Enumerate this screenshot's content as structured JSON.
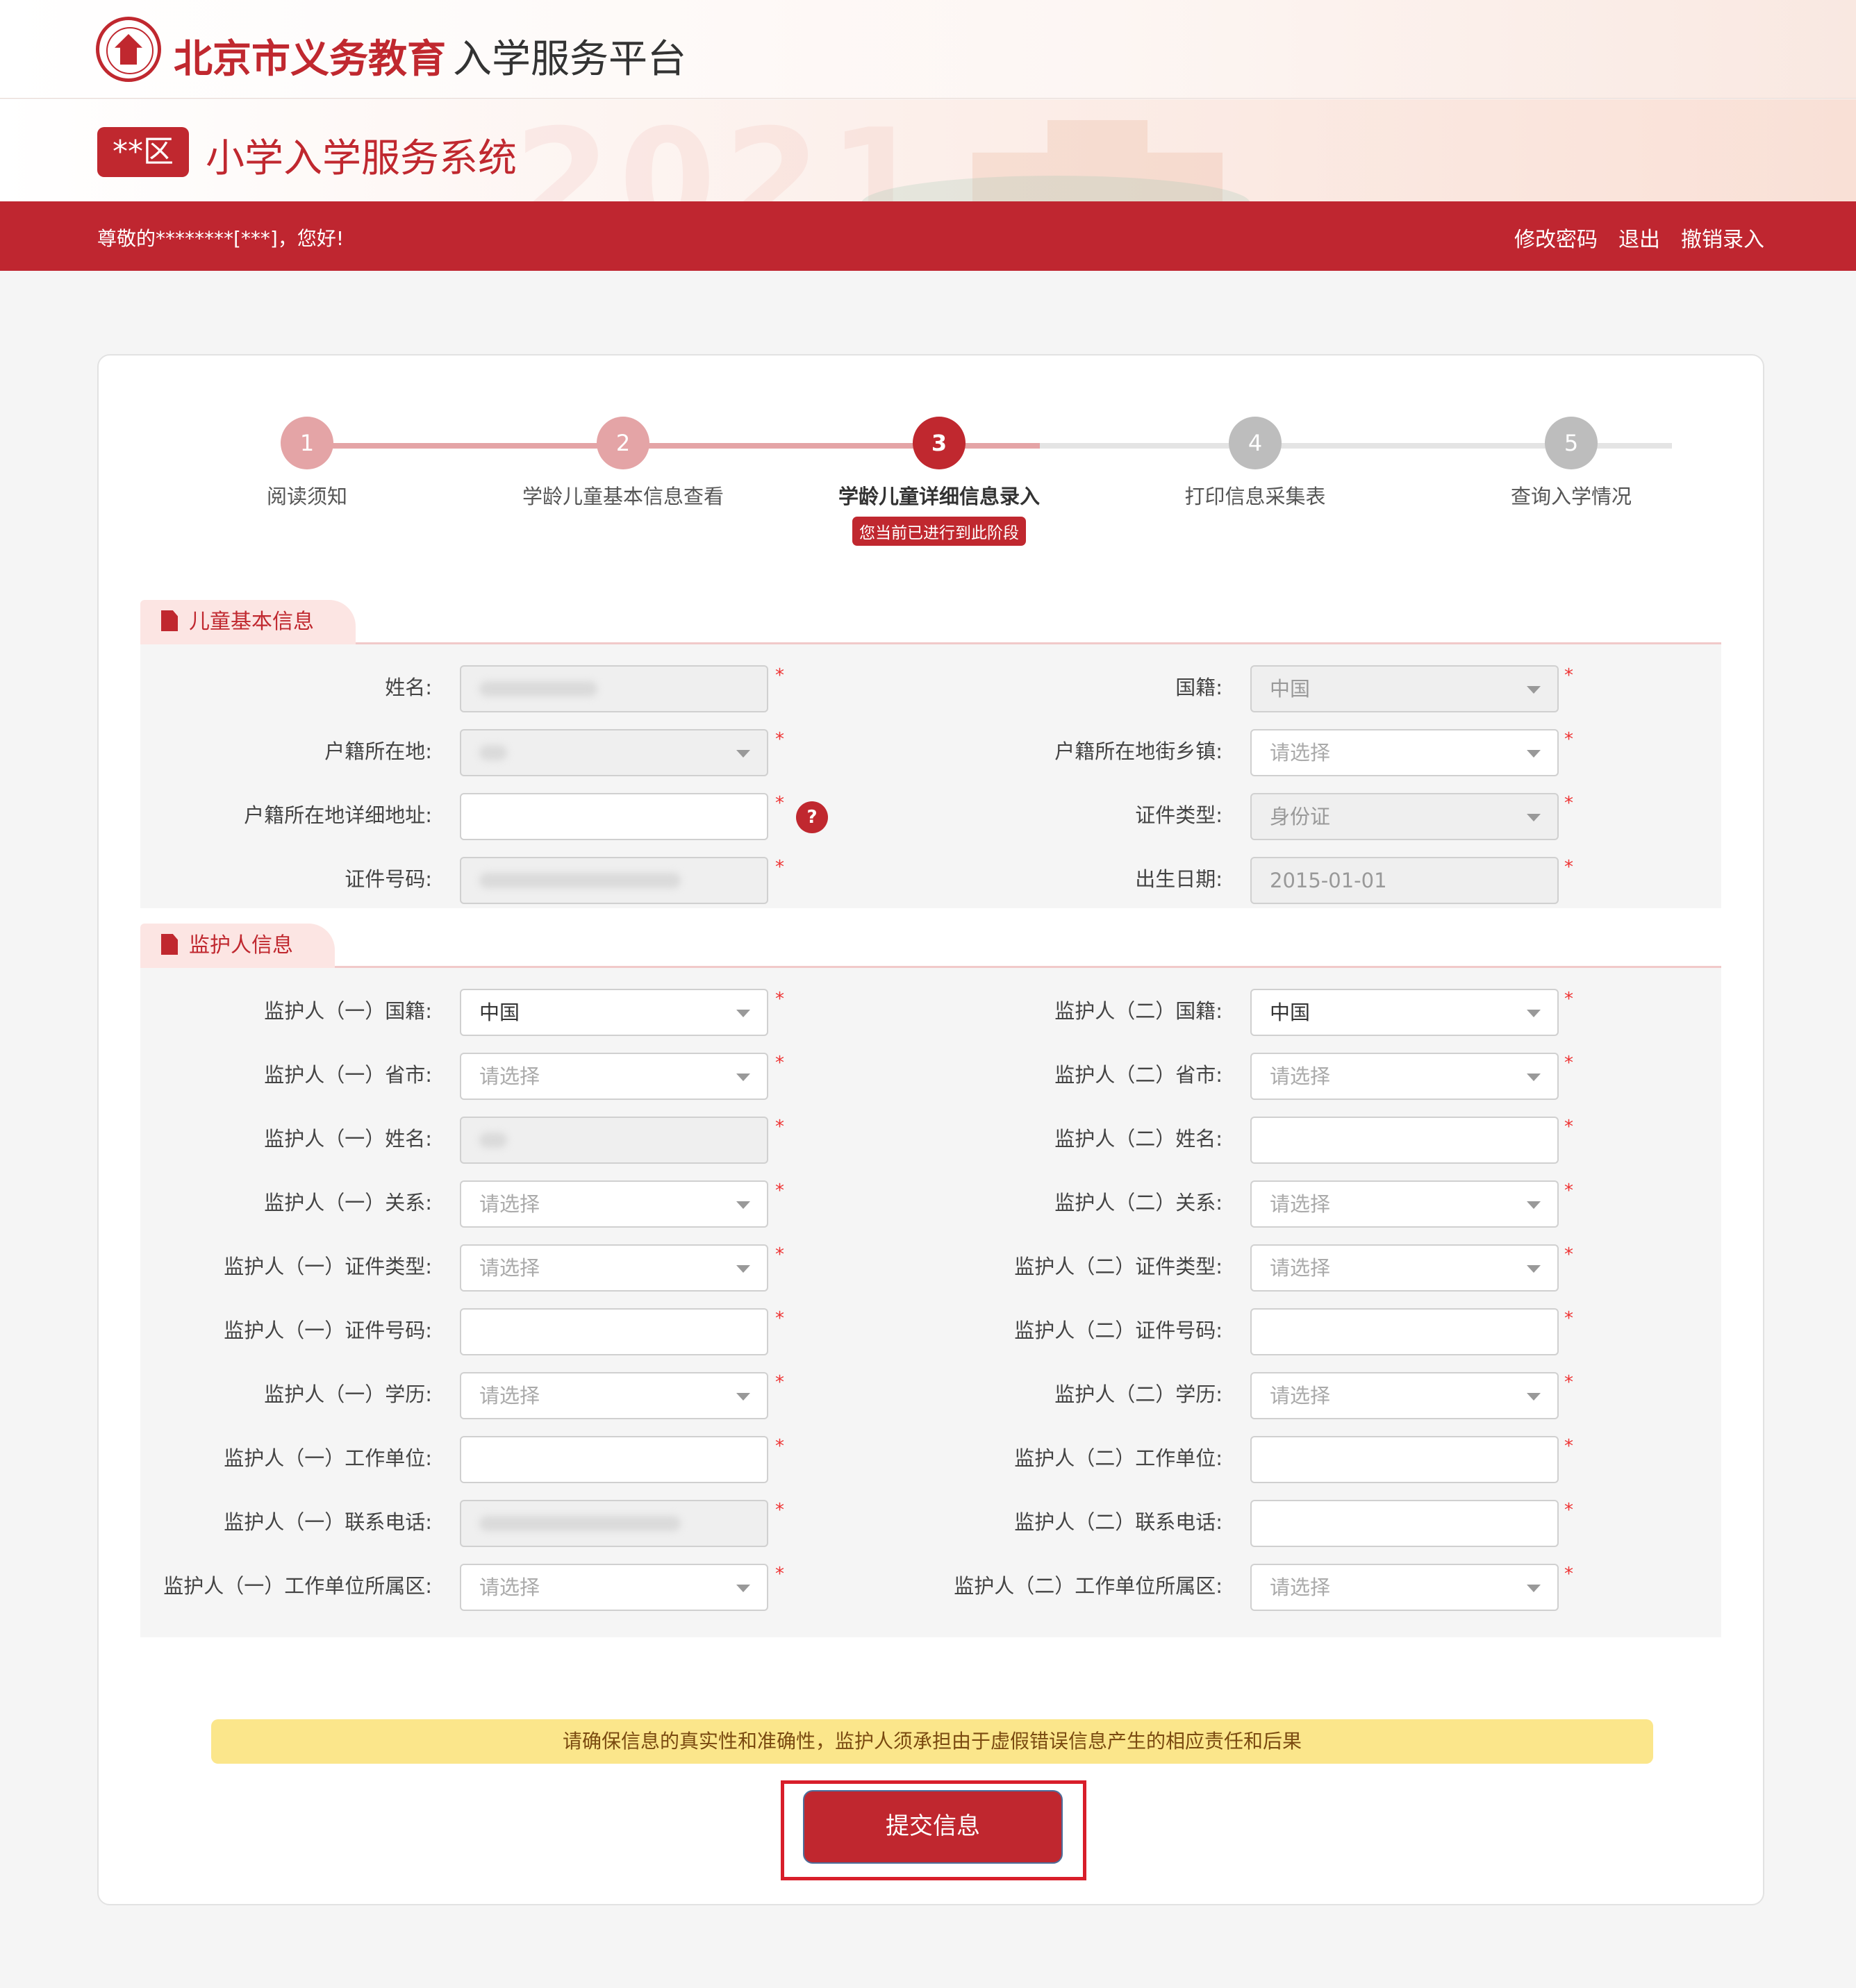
{
  "header": {
    "title_bold": "北京市义务教育",
    "title_thin": "入学服务平台",
    "district": "**区",
    "system_title": "小学入学服务系统",
    "deco_year": "2021"
  },
  "navbar": {
    "greeting": "尊敬的********[***]，您好!",
    "change_password": "修改密码",
    "logout": "退出",
    "cancel_entry": "撤销录入"
  },
  "steps": [
    {
      "num": "1",
      "label": "阅读须知",
      "status": "done"
    },
    {
      "num": "2",
      "label": "学龄儿童基本信息查看",
      "status": "done"
    },
    {
      "num": "3",
      "label": "学龄儿童详细信息录入",
      "status": "active",
      "tip": "您当前已进行到此阶段"
    },
    {
      "num": "4",
      "label": "打印信息采集表",
      "status": "todo"
    },
    {
      "num": "5",
      "label": "查询入学情况",
      "status": "todo"
    }
  ],
  "sections": {
    "child": {
      "title": "儿童基本信息",
      "fields": [
        {
          "label": "姓名:",
          "value": "",
          "type": "disabled",
          "required": "*"
        },
        {
          "label": "国籍:",
          "value": "中国",
          "type": "disabled-select",
          "required": "*"
        },
        {
          "label": "户籍所在地:",
          "value": "",
          "type": "disabled-select",
          "required": "*"
        },
        {
          "label": "户籍所在地街乡镇:",
          "value": "请选择",
          "type": "select",
          "required": "*"
        },
        {
          "label": "户籍所在地详细地址:",
          "value": "",
          "type": "input",
          "required": "*",
          "help": "?"
        },
        {
          "label": "证件类型:",
          "value": "身份证",
          "type": "disabled-select",
          "required": "*"
        },
        {
          "label": "证件号码:",
          "value": "",
          "type": "disabled",
          "required": "*"
        },
        {
          "label": "出生日期:",
          "value": "2015-01-01",
          "type": "disabled",
          "required": "*"
        }
      ]
    },
    "guardian": {
      "title": "监护人信息",
      "fields": [
        {
          "label": "监护人（一）国籍:",
          "value": "中国",
          "type": "select-filled",
          "required": "*"
        },
        {
          "label": "监护人（二）国籍:",
          "value": "中国",
          "type": "select-filled",
          "required": "*"
        },
        {
          "label": "监护人（一）省市:",
          "value": "请选择",
          "type": "select",
          "required": "*"
        },
        {
          "label": "监护人（二）省市:",
          "value": "请选择",
          "type": "select",
          "required": "*"
        },
        {
          "label": "监护人（一）姓名:",
          "value": "",
          "type": "disabled",
          "required": "*"
        },
        {
          "label": "监护人（二）姓名:",
          "value": "",
          "type": "input",
          "required": "*"
        },
        {
          "label": "监护人（一）关系:",
          "value": "请选择",
          "type": "select",
          "required": "*"
        },
        {
          "label": "监护人（二）关系:",
          "value": "请选择",
          "type": "select",
          "required": "*"
        },
        {
          "label": "监护人（一）证件类型:",
          "value": "请选择",
          "type": "select",
          "required": "*"
        },
        {
          "label": "监护人（二）证件类型:",
          "value": "请选择",
          "type": "select",
          "required": "*"
        },
        {
          "label": "监护人（一）证件号码:",
          "value": "",
          "type": "input",
          "required": "*"
        },
        {
          "label": "监护人（二）证件号码:",
          "value": "",
          "type": "input",
          "required": "*"
        },
        {
          "label": "监护人（一）学历:",
          "value": "请选择",
          "type": "select",
          "required": "*"
        },
        {
          "label": "监护人（二）学历:",
          "value": "请选择",
          "type": "select",
          "required": "*"
        },
        {
          "label": "监护人（一）工作单位:",
          "value": "",
          "type": "input",
          "required": "*"
        },
        {
          "label": "监护人（二）工作单位:",
          "value": "",
          "type": "input",
          "required": "*"
        },
        {
          "label": "监护人（一）联系电话:",
          "value": "",
          "type": "disabled",
          "required": "*"
        },
        {
          "label": "监护人（二）联系电话:",
          "value": "",
          "type": "input",
          "required": "*"
        },
        {
          "label": "监护人（一）工作单位所属区:",
          "value": "请选择",
          "type": "select",
          "required": "*"
        },
        {
          "label": "监护人（二）工作单位所属区:",
          "value": "请选择",
          "type": "select",
          "required": "*"
        }
      ]
    }
  },
  "notice": "请确保信息的真实性和准确性，监护人须承担由于虚假错误信息产生的相应责任和后果",
  "submit_label": "提交信息",
  "colors": {
    "brand": "#c0282f",
    "notice_bg": "#fbe68b",
    "highlight_frame": "#d81e2a"
  },
  "icons": {
    "logo": "school-emblem-icon",
    "section": "document-icon",
    "select": "chevron-down-icon",
    "help": "question-icon"
  }
}
